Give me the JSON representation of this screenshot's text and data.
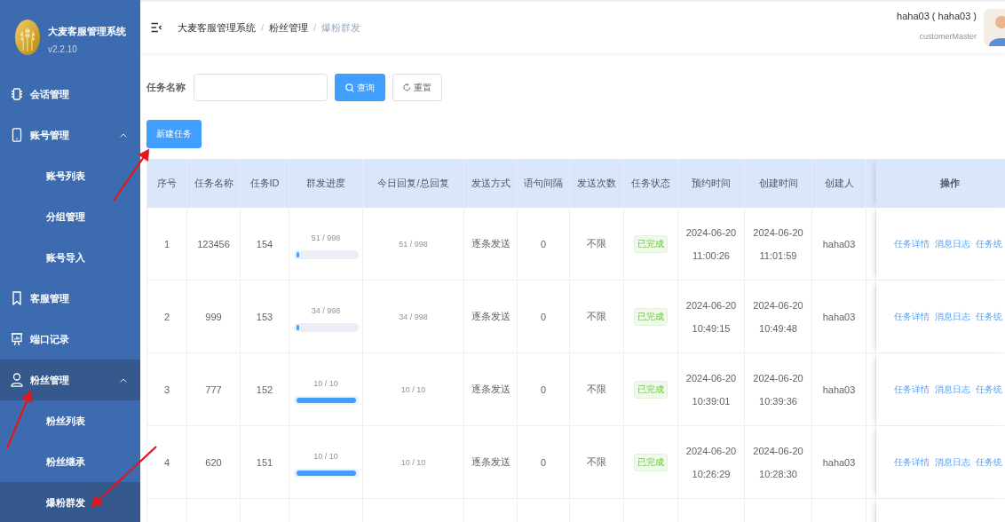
{
  "app": {
    "name": "大麦客服管理系统",
    "version": "v2.2.10"
  },
  "sidebar": {
    "items": [
      {
        "label": "会话管理",
        "selected": false,
        "expanded": false
      },
      {
        "label": "账号管理",
        "selected": false,
        "expanded": true,
        "children": [
          {
            "label": "账号列表",
            "selected": false
          },
          {
            "label": "分组管理",
            "selected": false
          },
          {
            "label": "账号导入",
            "selected": false
          }
        ]
      },
      {
        "label": "客服管理",
        "selected": false,
        "expanded": false
      },
      {
        "label": "端口记录",
        "selected": false,
        "expanded": false
      },
      {
        "label": "粉丝管理",
        "selected": true,
        "expanded": true,
        "children": [
          {
            "label": "粉丝列表",
            "selected": false
          },
          {
            "label": "粉丝继承",
            "selected": false
          },
          {
            "label": "爆粉群发",
            "selected": true
          }
        ]
      }
    ]
  },
  "breadcrumb": {
    "items": [
      {
        "label": "大麦客服管理系统",
        "current": false
      },
      {
        "label": "粉丝管理",
        "current": false
      },
      {
        "label": "爆粉群发",
        "current": true
      }
    ],
    "separators": [
      "/",
      "/"
    ]
  },
  "user": {
    "name": "haha03 ( haha03 )",
    "role": "customerMaster"
  },
  "search": {
    "label": "任务名称",
    "buttons": [
      {
        "label": "查询",
        "kind": "primary"
      },
      {
        "label": "重置",
        "kind": "default"
      }
    ]
  },
  "toolbar": {
    "buttons": [
      {
        "label": "新建任务",
        "kind": "primary"
      }
    ]
  },
  "table": {
    "columns": [
      "序号",
      "任务名称",
      "任务ID",
      "群发进度",
      "今日回复/总回复",
      "发送方式",
      "语句间隔",
      "发送次数",
      "任务状态",
      "预约时间",
      "创建时间",
      "创建人",
      "操作"
    ],
    "rows": [
      {
        "index": "1",
        "name": "123456",
        "id": "154",
        "progress": {
          "text": "51 / 998",
          "level": 0.05
        },
        "replies": "51 / 998",
        "mode": "逐条发送",
        "interval": "0",
        "count": "不限",
        "status": "已完成",
        "scheduled": "2024-06-20 11:00:26",
        "created": "2024-06-20 11:01:59",
        "creator": "haha03",
        "actions": [
          "任务详情",
          "消息日志",
          "任务统"
        ]
      },
      {
        "index": "2",
        "name": "999",
        "id": "153",
        "progress": {
          "text": "34 / 998",
          "level": 0.03
        },
        "replies": "34 / 998",
        "mode": "逐条发送",
        "interval": "0",
        "count": "不限",
        "status": "已完成",
        "scheduled": "2024-06-20 10:49:15",
        "created": "2024-06-20 10:49:48",
        "creator": "haha03",
        "actions": [
          "任务详情",
          "消息日志",
          "任务统"
        ]
      },
      {
        "index": "3",
        "name": "777",
        "id": "152",
        "progress": {
          "text": "10 / 10",
          "level": 1
        },
        "replies": "10 / 10",
        "mode": "逐条发送",
        "interval": "0",
        "count": "不限",
        "status": "已完成",
        "scheduled": "2024-06-20 10:39:01",
        "created": "2024-06-20 10:39:36",
        "creator": "haha03",
        "actions": [
          "任务详情",
          "消息日志",
          "任务统"
        ]
      },
      {
        "index": "4",
        "name": "620",
        "id": "151",
        "progress": {
          "text": "10 / 10",
          "level": 1
        },
        "replies": "10 / 10",
        "mode": "逐条发送",
        "interval": "0",
        "count": "不限",
        "status": "已完成",
        "scheduled": "2024-06-20 10:26:29",
        "created": "2024-06-20 10:28:30",
        "creator": "haha03",
        "actions": [
          "任务详情",
          "消息日志",
          "任务统"
        ]
      }
    ]
  }
}
